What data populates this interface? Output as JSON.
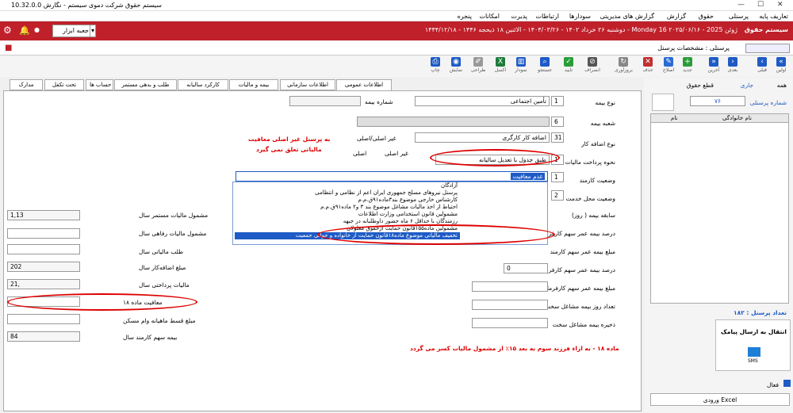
{
  "app": {
    "title": "سیستم حقوق شرکت دموی سیستم - نگارش 10.32.0.0"
  },
  "menu": [
    "تعاریف پایه",
    "پرسنلی",
    "حقوق",
    "گزارش",
    "گزارش های مدیریتی",
    "سودارها",
    "ارتباطات",
    "پدیرت",
    "امکانات",
    "پنجره"
  ],
  "header": {
    "sys": "سیستم حقوق",
    "date_text": "دوشنبه ۲۶ خرداد ۱۴۰۲ - ۱۴۰۴/۰۳/۲۶ - الاثنین ۱۸ ذیحجه ۱۴۴۶ - ۱۴۴۴/۱۲/۱۸ - Monday 16 ژوئن 2025 - ۲۰۲۵/۰۶/۱۶",
    "combo": "جعبه ابزار"
  },
  "doc": {
    "title": "پرسنلی : مشخصات پرسنل"
  },
  "toolbar": [
    "اولین",
    "قبلی",
    "بعدی",
    "آخرین",
    "جدید",
    "اصلاح",
    "حذف",
    "بروزآوری",
    "انصراف",
    "تایید",
    "جستجو",
    "نمودار",
    "اکسل",
    "طراحی",
    "نمایش",
    "چاپ"
  ],
  "tabs": [
    "اطلاعات عمومی",
    "بیمه و مالیات",
    "اطلاعات سازمانی",
    "کارکرد سالیانه",
    "طلب و بدهی مستمر",
    "حساب ها",
    "تحت تکفل",
    "مدارک"
  ],
  "right_labels": [
    "نوع بیمه",
    "شعبه بیمه",
    "نوع اضافه کار",
    "نحوه پرداخت مالیات",
    "وضعیت کارمند",
    "وضعیت محل خدمت",
    "سابقه بیمه ( روز)",
    "درصد بیمه عمر سهم کارفرما",
    "مبلغ بیمه عمر سهم کارمند",
    "درصد بیمه عمر سهم کارفرما",
    "مبلغ بیمه عمر سهم کارفرما",
    "تعداد روز بیمه مشاغل سخت",
    "ذخیره بیمه مشاغل سخت"
  ],
  "fields": {
    "insurance_type_code": "1",
    "insurance_type": "تأمین اجتماعی",
    "insurance_no_label": "شماره بیمه",
    "branch_code": "6",
    "overtime_code": "31",
    "overtime": "اضافه کار کارگری",
    "tax_method_code": "1",
    "tax_method": "طبق جدول با تعدیل سالیانه",
    "status_code": "1",
    "status": "عدم معافیت",
    "place_code": "2",
    "nonprincipal": "غیر اصلی/اصلی",
    "r1": "غیر اصلی",
    "r2": "اصلی",
    "life_share_val": "0"
  },
  "dropdown": [
    "آزادگان",
    "پرسنل نیروهای مسلح جمهوری ایران اعم از نظامی و انتظامی",
    "کارشناس خارجی موضوع بند۳ماده۹۱ق.م.م",
    "احتیاط از اخذ مالیات مشاغل موضوع بند ۳ و۲ ماده۹۱ق.م.م",
    "مشمولین قانون استخدامی وزارت اطلاعات",
    "رزمندگان با حداقل ۶ ماه حضور داوطلبانه در جبهه",
    "مشمولین ماده۱۵۵قانون حمایت ازحقوق معلولان",
    "تخفیف مالیاتی موضوع ماده۱۸قانون حمایت از خانواده و جوانی جمعیت"
  ],
  "left_labels": [
    "مشمول مالیات مستمر سال",
    "مشمول مالیات رفاهی سال",
    "طلب مالیاتی سال",
    "مبلغ اضافه‌کار سال",
    "مالیات پرداختی سال",
    "معافیت ماده ۱۸",
    "مبلغ قسط ماهیانه وام مسکن",
    "بیمه سهم کارمند سال"
  ],
  "left_values": [
    "1,13",
    "",
    "",
    "202",
    "21,",
    "",
    "",
    "84"
  ],
  "notes": {
    "n1": "به پرسنل غیر اصلی معافیت",
    "n2": "مالیاتی تعلق نمی گیرد",
    "n3": "ماده ۱۸ - به ازاء فرزند سوم به بعد ۱۵٪ از مشمول مالیات کسر می گردد"
  },
  "panel": {
    "all": "همه",
    "active": "جاری",
    "cut": "قطع حقوق",
    "pno_label": "شماره پرسنلی",
    "pno": "۷۶",
    "col1": "نام",
    "col2": "نام خانوادگی",
    "count": "تعداد پرسنل : ۱۸۲",
    "sms": "انتقال به ارسال پیامک",
    "sms_icon": "SMS",
    "active_chk": "فعال",
    "excel": "ورودی Excel"
  },
  "colors": {
    "red": "#c0202a",
    "blue": "#1e5bc6"
  }
}
